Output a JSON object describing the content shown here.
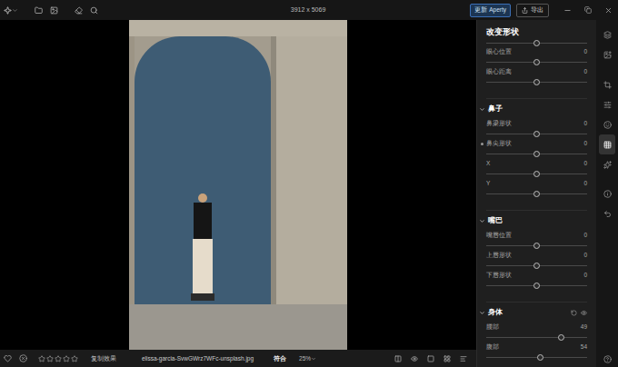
{
  "topbar": {
    "dimensions": "3912 x 5069",
    "update_button": "更新 Aperty",
    "export_button": "导出"
  },
  "panel": {
    "title": "改变形状",
    "top_items": [
      {
        "kind": "track",
        "level": 0.5
      },
      {
        "kind": "slider",
        "label": "眼心位置",
        "value": "0",
        "level": 0.5,
        "modified": false
      },
      {
        "kind": "slider",
        "label": "眼心距离",
        "value": "0",
        "level": 0.5,
        "modified": false
      }
    ],
    "sections": [
      {
        "title": "鼻子",
        "expanded": true,
        "resettable": false,
        "items": [
          {
            "kind": "slider",
            "label": "鼻梁形状",
            "value": "0",
            "level": 0.5,
            "modified": false
          },
          {
            "kind": "slider",
            "label": "鼻尖形状",
            "value": "0",
            "level": 0.5,
            "modified": true
          },
          {
            "kind": "slider",
            "label": "X",
            "value": "0",
            "level": 0.5,
            "modified": false
          },
          {
            "kind": "slider",
            "label": "Y",
            "value": "0",
            "level": 0.5,
            "modified": false
          }
        ]
      },
      {
        "title": "嘴巴",
        "expanded": true,
        "resettable": false,
        "items": [
          {
            "kind": "slider",
            "label": "嘴唇位置",
            "value": "0",
            "level": 0.5,
            "modified": false
          },
          {
            "kind": "slider",
            "label": "上唇形状",
            "value": "0",
            "level": 0.5,
            "modified": false
          },
          {
            "kind": "slider",
            "label": "下唇形状",
            "value": "0",
            "level": 0.5,
            "modified": false
          }
        ]
      },
      {
        "title": "身体",
        "expanded": true,
        "resettable": true,
        "items": [
          {
            "kind": "slider",
            "label": "腰部",
            "value": "49",
            "level": 0.74,
            "modified": false
          },
          {
            "kind": "slider",
            "label": "腹部",
            "value": "54",
            "level": 0.54,
            "modified": false
          }
        ]
      }
    ]
  },
  "sidebar_tools": [
    {
      "selected": false
    },
    {
      "selected": false
    },
    {
      "selected": false
    },
    {
      "selected": false
    },
    {
      "selected": false
    },
    {
      "selected": true
    },
    {
      "selected": false
    },
    {
      "selected": false
    },
    {
      "selected": false
    }
  ],
  "bottom_bar": {
    "favorite": false,
    "stars": 0,
    "max_stars": 5,
    "copy_button": "复制效果",
    "filename": "elissa-garcia-SvwGWrz7WFc-unsplash.jpg",
    "fit": "符合",
    "zoom": "25%"
  }
}
